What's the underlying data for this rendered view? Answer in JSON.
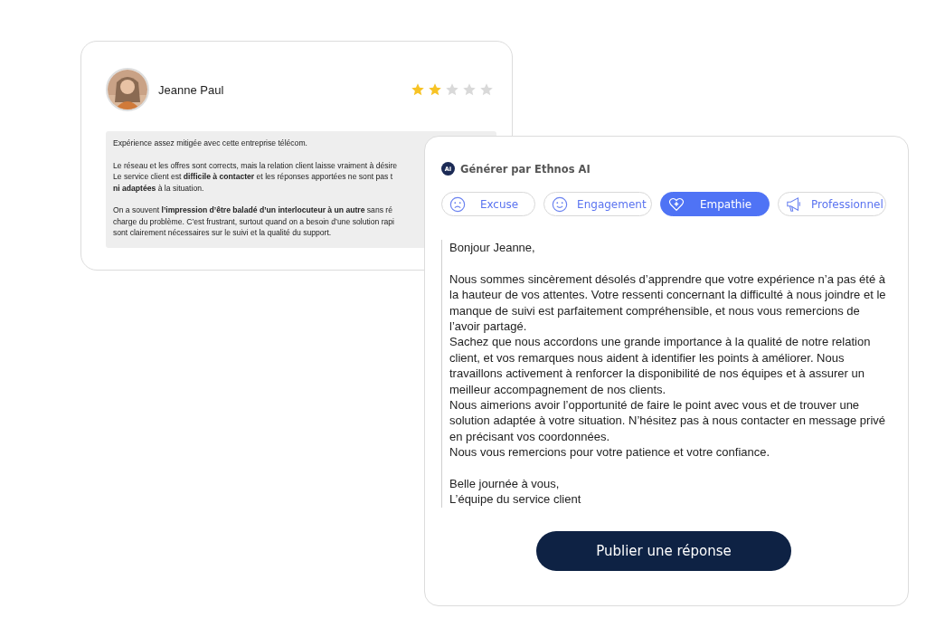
{
  "review": {
    "author": "Jeanne Paul",
    "stars": 2,
    "paragraphs": [
      [
        "Expérience assez mitigée avec cette entreprise télécom."
      ],
      [
        "Le réseau et les offres sont corrects, mais la relation client laisse vraiment à désire",
        "Le service client est **difficile à contacter** et les réponses apportées ne sont pas t",
        "**ni adaptées** à la situation."
      ],
      [
        "On a souvent **l’impression d’être baladé d’un interlocuteur à un autre** sans ré",
        "charge du problème. C’est frustrant, surtout quand on a besoin d’une solution rapi",
        "sont clairement nécessaires sur le suivi et la qualité du support."
      ]
    ]
  },
  "reply": {
    "ai_badge": "AI",
    "title": "Générer par Ethnos AI",
    "tones": [
      {
        "label": "Excuse",
        "kind": "sad",
        "selected": false
      },
      {
        "label": "Engagement",
        "kind": "smile",
        "selected": false
      },
      {
        "label": "Empathie",
        "kind": "heart",
        "selected": true
      },
      {
        "label": "Professionnel",
        "kind": "megaphone",
        "selected": false
      }
    ],
    "greeting": "Bonjour Jeanne,",
    "body": [
      "Nous sommes sincèrement désolés d’apprendre que votre expérience n’a pas été à la hauteur de vos attentes. Votre ressenti concernant la difficulté à nous joindre et le manque de suivi est parfaitement compréhensible, et nous vous remercions de l’avoir partagé.",
      "Sachez que nous accordons une grande importance à la qualité de notre relation client, et vos remarques nous aident à identifier les points à améliorer. Nous travaillons activement à renforcer la disponibilité de nos équipes et à assurer un meilleur accompagnement de nos clients.",
      "Nous aimerions avoir l’opportunité de faire le point avec vous et de trouver une solution adaptée à votre situation. N’hésitez pas à nous contacter en message privé en précisant vos coordonnées.",
      "Nous vous remercions pour votre patience et votre confiance."
    ],
    "closing": [
      "Belle journée à vous,",
      "L’équipe du service client"
    ],
    "publish_button": "Publier une réponse"
  }
}
